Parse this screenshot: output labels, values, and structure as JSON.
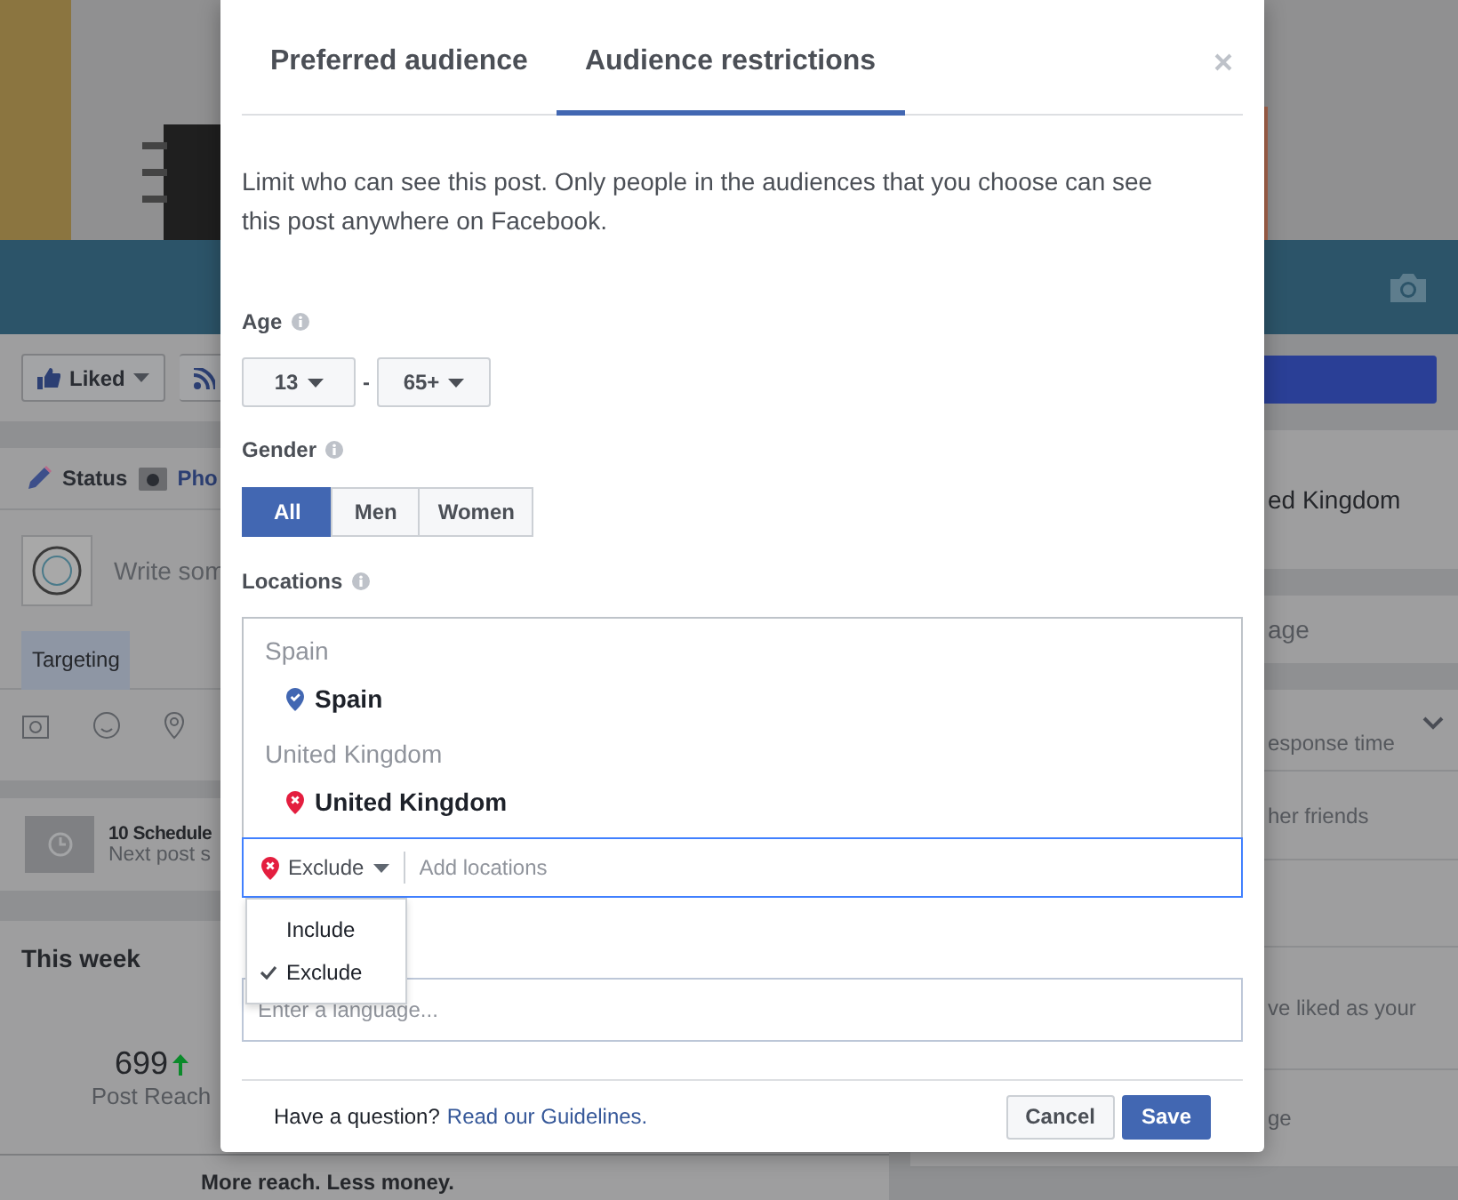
{
  "background": {
    "liked_button": "Liked",
    "composer_tabs": [
      "Status",
      "Pho"
    ],
    "composer_placeholder": "Write som",
    "targeting": "Targeting",
    "scheduled": {
      "title": "10 Schedule",
      "subtitle": "Next post s"
    },
    "this_week": {
      "title": "This week",
      "value": "699",
      "label": "Post Reach"
    },
    "promo": "More reach. Less money.",
    "right_items": [
      {
        "kind": "card",
        "text": "ed Kingdom"
      },
      {
        "kind": "card",
        "text": "age"
      },
      {
        "kind": "row",
        "text": "esponse time"
      },
      {
        "kind": "row",
        "text": "her friends"
      },
      {
        "kind": "row"
      },
      {
        "kind": "row",
        "text": "ve liked as your"
      },
      {
        "kind": "row",
        "text": "ge"
      }
    ]
  },
  "dialog": {
    "tabs": [
      {
        "label": "Preferred audience",
        "selected": false
      },
      {
        "label": "Audience restrictions",
        "selected": true
      }
    ],
    "description": "Limit who can see this post. Only people in the audiences that you choose can see this post anywhere on Facebook.",
    "age": {
      "label": "Age",
      "from": "13",
      "separator": "-",
      "to": "65+"
    },
    "gender": {
      "label": "Gender",
      "options": [
        {
          "label": "All",
          "selected": true
        },
        {
          "label": "Men",
          "selected": false
        },
        {
          "label": "Women",
          "selected": false
        }
      ]
    },
    "locations": {
      "label": "Locations",
      "groups": [
        {
          "title": "Spain",
          "items": [
            {
              "name": "Spain",
              "kind": "include"
            }
          ]
        },
        {
          "title": "United Kingdom",
          "items": [
            {
              "name": "United Kingdom",
              "kind": "exclude"
            }
          ]
        }
      ],
      "input": {
        "mode": "Exclude",
        "kind": "exclude",
        "placeholder": "Add locations"
      },
      "menu": [
        {
          "label": "Include",
          "selected": false
        },
        {
          "label": "Exclude",
          "selected": true
        }
      ]
    },
    "language": {
      "placeholder": "Enter a language..."
    },
    "footer": {
      "question": "Have a question?",
      "link": "Read our Guidelines.",
      "buttons": [
        {
          "label": "Cancel",
          "kind": "secondary"
        },
        {
          "label": "Save",
          "kind": "primary"
        }
      ]
    }
  }
}
